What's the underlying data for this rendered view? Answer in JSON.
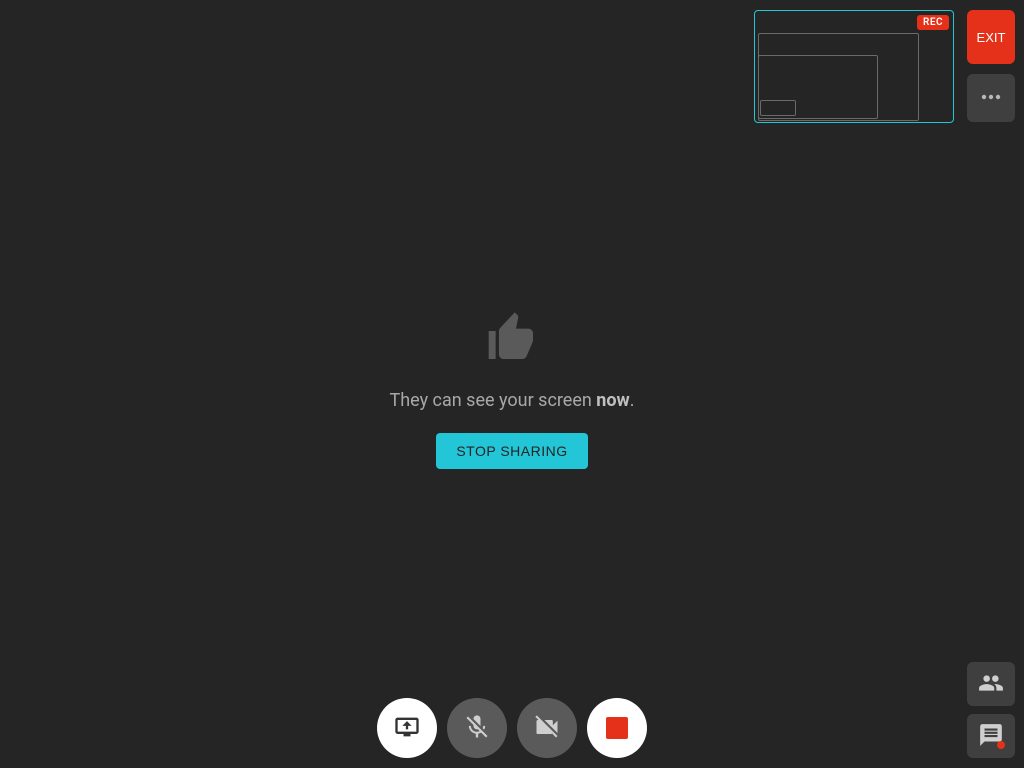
{
  "preview": {
    "rec_label": "REC"
  },
  "side": {
    "exit_label": "EXIT"
  },
  "center": {
    "message_prefix": "They can see your screen ",
    "message_emphasis": "now",
    "message_suffix": ".",
    "stop_button_label": "STOP SHARING"
  },
  "icons": {
    "thumbs_up": "thumbs-up-icon",
    "share_screen": "screen-share-icon",
    "mic_off": "mic-off-icon",
    "camera_off": "camera-off-icon",
    "stop_record": "stop-record-icon",
    "more": "more-icon",
    "participants": "participants-icon",
    "chat": "chat-icon"
  },
  "colors": {
    "accent": "#22c6d6",
    "danger": "#e53119",
    "bg": "#252525",
    "panel": "#3f3f3f"
  }
}
